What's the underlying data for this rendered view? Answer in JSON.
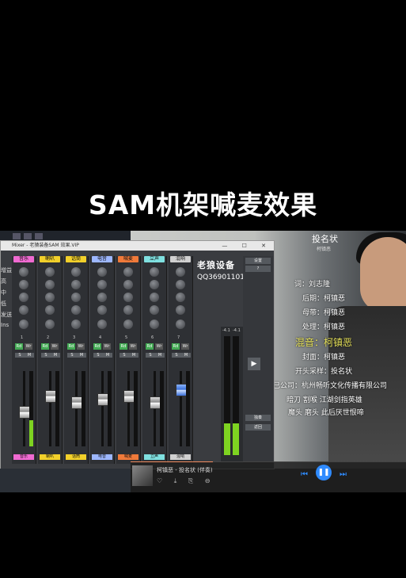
{
  "overlay_title": "SAM机架喊麦效果",
  "mixer": {
    "window_title": "Mixer - 老猿装备SAM 效果.VIP",
    "controls": "—  ☐  ✕",
    "row_labels": [
      "增益",
      "高",
      "中",
      "低",
      "发送",
      "Ins"
    ],
    "channels": [
      {
        "name": "音乐",
        "color": "#f06ad1",
        "fader": 0.55,
        "meter": 0.35,
        "cap": "gray"
      },
      {
        "name": "喇叭",
        "color": "#f2d02a",
        "fader": 0.3,
        "meter": 0.0,
        "cap": "gray"
      },
      {
        "name": "话筒",
        "color": "#f2d02a",
        "fader": 0.4,
        "meter": 0.0,
        "cap": "gray"
      },
      {
        "name": "电音",
        "color": "#9db7ff",
        "fader": 0.35,
        "meter": 0.0,
        "cap": "gray"
      },
      {
        "name": "喊麦",
        "color": "#f07a3a",
        "fader": 0.3,
        "meter": 0.0,
        "cap": "gray"
      },
      {
        "name": "立声",
        "color": "#7fe0e0",
        "fader": 0.4,
        "meter": 0.0,
        "cap": "gray"
      },
      {
        "name": "混响",
        "color": "#d0d0d0",
        "fader": 0.2,
        "meter": 0.0,
        "cap": "blue"
      }
    ],
    "channel_numbers": [
      "1",
      "2",
      "3",
      "4",
      "5",
      "6",
      "7"
    ],
    "sponsor_line1": "老狼设备",
    "sponsor_line2": "QQ369011017",
    "side_buttons": [
      "设置",
      "?",
      "独奏",
      "返回"
    ],
    "master_values": [
      "-4.1",
      "-4.1"
    ]
  },
  "song": {
    "title": "投名状",
    "subtitle": "柯镇恶",
    "credits": [
      {
        "text": "词：刘志隆",
        "hl": false
      },
      {
        "text": "后期：柯镇恶",
        "hl": false
      },
      {
        "text": "母带：柯镇恶",
        "hl": false
      },
      {
        "text": "处理：柯镇恶",
        "hl": false
      },
      {
        "text": "混音：柯镇恶",
        "hl": true
      },
      {
        "text": "封面：柯镇恶",
        "hl": false
      },
      {
        "text": "开头采样：投名状",
        "hl": false
      },
      {
        "text": "己公司：杭州畅听文化传播有限公司",
        "hl": false
      },
      {
        "text": "暗刀 割喉 江湖剑指英雄",
        "hl": false
      },
      {
        "text": "魔头 磨头 此后厌世恨啼",
        "hl": false
      }
    ]
  },
  "player": {
    "now_playing": "柯镇恶 - 投名状 (伴奏)",
    "icons": "♡ ⤓ ⎘ ⊖",
    "prev": "⏮",
    "play": "❚❚",
    "next": "⏭",
    "progress": 0.3
  },
  "colors": {
    "accent": "#2f8bff",
    "meter": "#7ed321",
    "highlight": "#e8e35a"
  }
}
